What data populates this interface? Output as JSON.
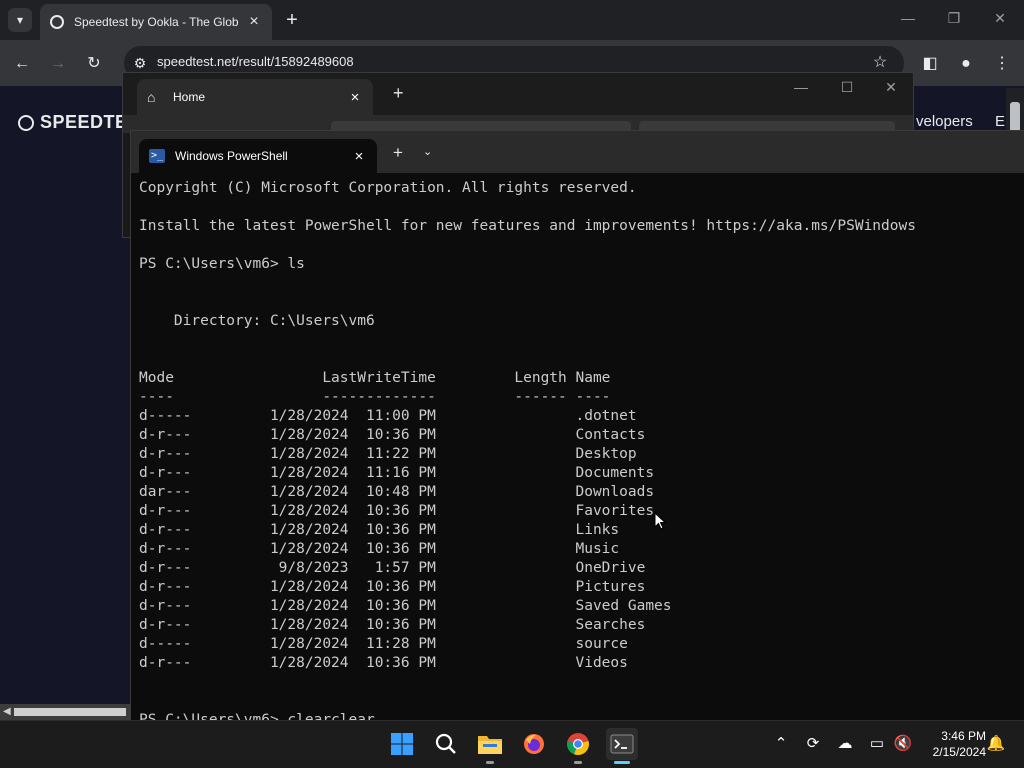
{
  "chrome": {
    "tab_title": "Speedtest by Ookla - The Glob",
    "url": "speedtest.net/result/15892489608",
    "page": {
      "logo_text": "SPEEDTE",
      "nav_items": [
        "velopers",
        "E"
      ]
    }
  },
  "explorer": {
    "tab_title": "Home"
  },
  "terminal": {
    "tab_title": "Windows PowerShell",
    "lines": [
      "Copyright (C) Microsoft Corporation. All rights reserved.",
      "",
      "Install the latest PowerShell for new features and improvements! https://aka.ms/PSWindows",
      "",
      "PS C:\\Users\\vm6> ls",
      "",
      "",
      "    Directory: C:\\Users\\vm6",
      "",
      "",
      "Mode                 LastWriteTime         Length Name",
      "----                 -------------         ------ ----",
      "d-----         1/28/2024  11:00 PM                .dotnet",
      "d-r---         1/28/2024  10:36 PM                Contacts",
      "d-r---         1/28/2024  11:22 PM                Desktop",
      "d-r---         1/28/2024  11:16 PM                Documents",
      "dar---         1/28/2024  10:48 PM                Downloads",
      "d-r---         1/28/2024  10:36 PM                Favorites",
      "d-r---         1/28/2024  10:36 PM                Links",
      "d-r---         1/28/2024  10:36 PM                Music",
      "d-r---          9/8/2023   1:57 PM                OneDrive",
      "d-r---         1/28/2024  10:36 PM                Pictures",
      "d-r---         1/28/2024  10:36 PM                Saved Games",
      "d-r---         1/28/2024  10:36 PM                Searches",
      "d-----         1/28/2024  11:28 PM                source",
      "d-r---         1/28/2024  10:36 PM                Videos",
      "",
      "",
      "PS C:\\Users\\vm6> clearclear"
    ]
  },
  "taskbar": {
    "time": "3:46 PM",
    "date": "2/15/2024"
  }
}
